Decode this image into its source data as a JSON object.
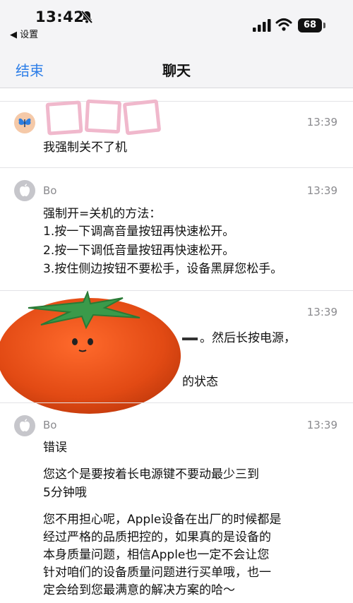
{
  "status_bar": {
    "time": "13:42",
    "back_app": "◀ 设置",
    "battery": "68"
  },
  "nav": {
    "left_button": "结束",
    "title": "聊天"
  },
  "messages": [
    {
      "sender": "",
      "time": "13:39",
      "lines": [
        "我强制关不了机"
      ]
    },
    {
      "sender": "Bo",
      "time": "13:39",
      "lines": [
        "强制开=关机的方法：",
        "1.按一下调高音量按钮再快速松开。",
        "2.按一下调低音量按钮再快速松开。",
        "3.按住侧边按钮不要松手，设备黑屏您松手。"
      ]
    },
    {
      "sender": "",
      "time": "13:39",
      "lines": [
        "。然后长按电源，",
        "的状态"
      ]
    },
    {
      "sender": "Bo",
      "time": "13:39",
      "lines": [
        "错误",
        "您这个是要按着长电源键不要动最少三到",
        "5分钟哦",
        "您不用担心呢，Apple设备在出厂的时候都是",
        "经过严格的品质把控的，如果真的是设备的",
        "本身质量问题，相信Apple也一定不会让您",
        "针对咱们的设备质量问题进行买单哦，也一",
        "定会给到您最满意的解决方案的哈～"
      ]
    }
  ]
}
